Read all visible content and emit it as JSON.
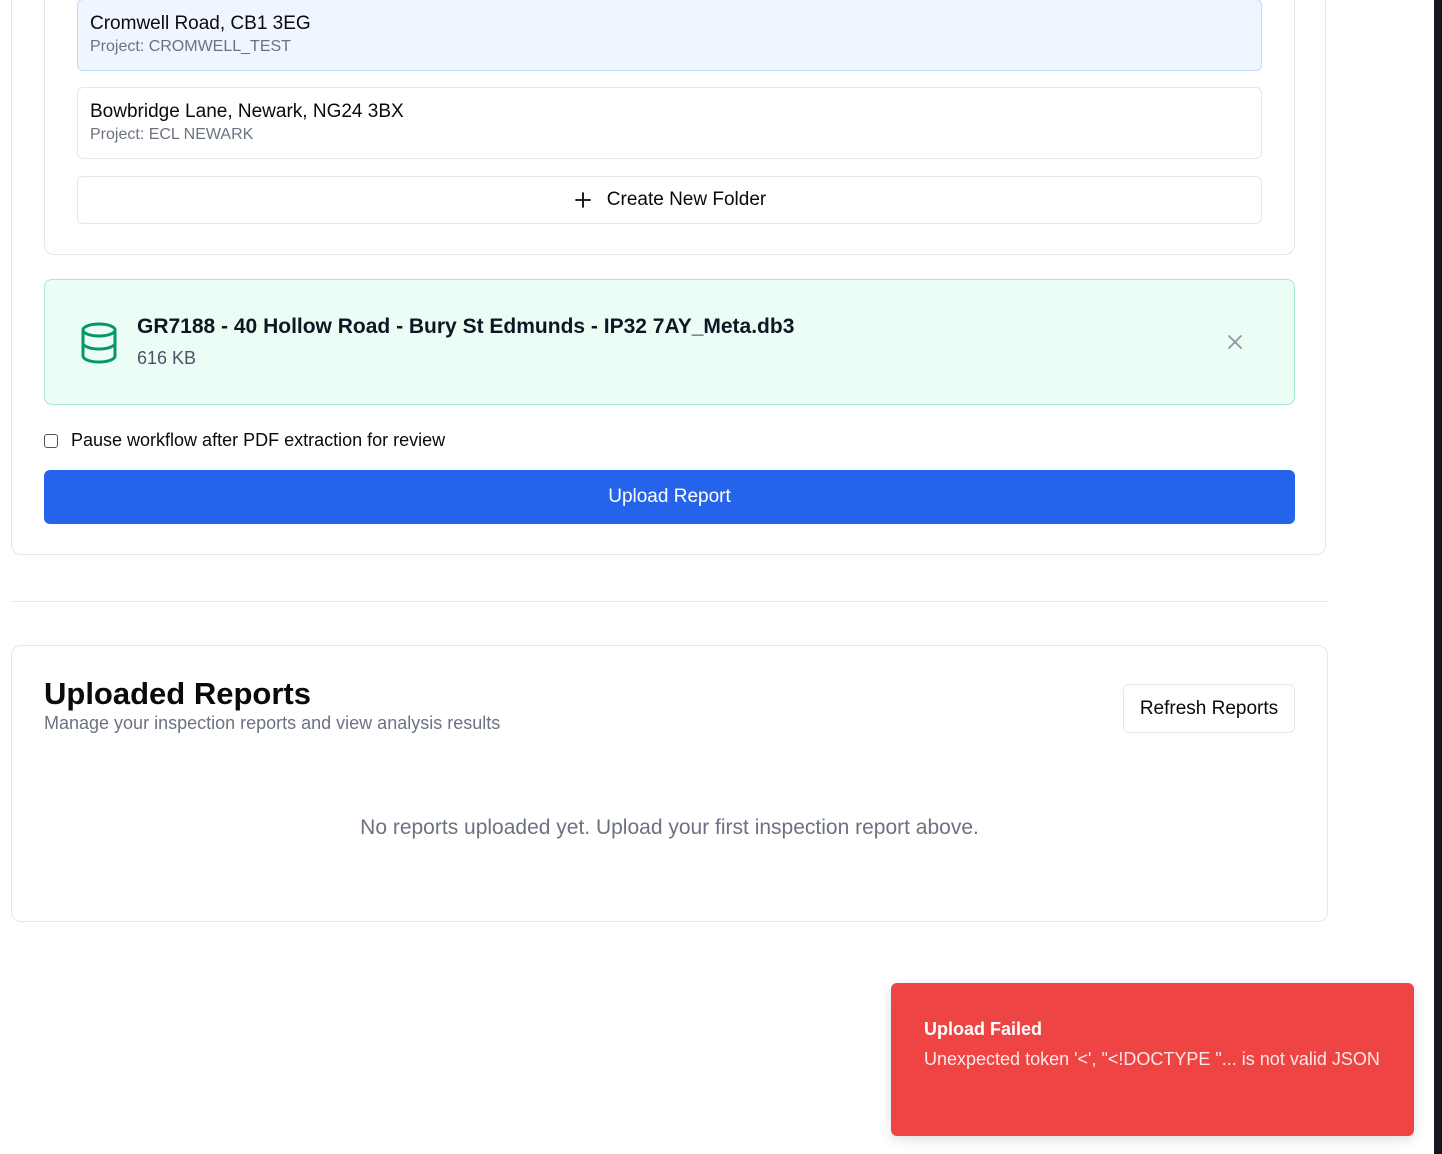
{
  "folders": [
    {
      "address": "Cromwell Road, CB1 3EG",
      "project": "Project: CROMWELL_TEST",
      "selected": true
    },
    {
      "address": "Bowbridge Lane, Newark, NG24 3BX",
      "project": "Project: ECL NEWARK",
      "selected": false
    }
  ],
  "create_folder_label": "Create New Folder",
  "file": {
    "name": "GR7188 - 40 Hollow Road - Bury St Edmunds - IP32 7AY_Meta.db3",
    "size": "616 KB",
    "icon": "database-icon"
  },
  "pause_checkbox": {
    "label": "Pause workflow after PDF extraction for review",
    "checked": false
  },
  "upload_button_label": "Upload Report",
  "reports": {
    "title": "Uploaded Reports",
    "subtitle": "Manage your inspection reports and view analysis results",
    "refresh_label": "Refresh Reports",
    "empty_message": "No reports uploaded yet. Upload your first inspection report above."
  },
  "toast": {
    "title": "Upload Failed",
    "message": "Unexpected token '<', \"<!DOCTYPE \"... is not valid JSON"
  },
  "colors": {
    "primary": "#2563eb",
    "success_bg": "#ecfdf5",
    "success_icon": "#059669",
    "error": "#ef4444",
    "selected_bg": "#eff6ff"
  }
}
